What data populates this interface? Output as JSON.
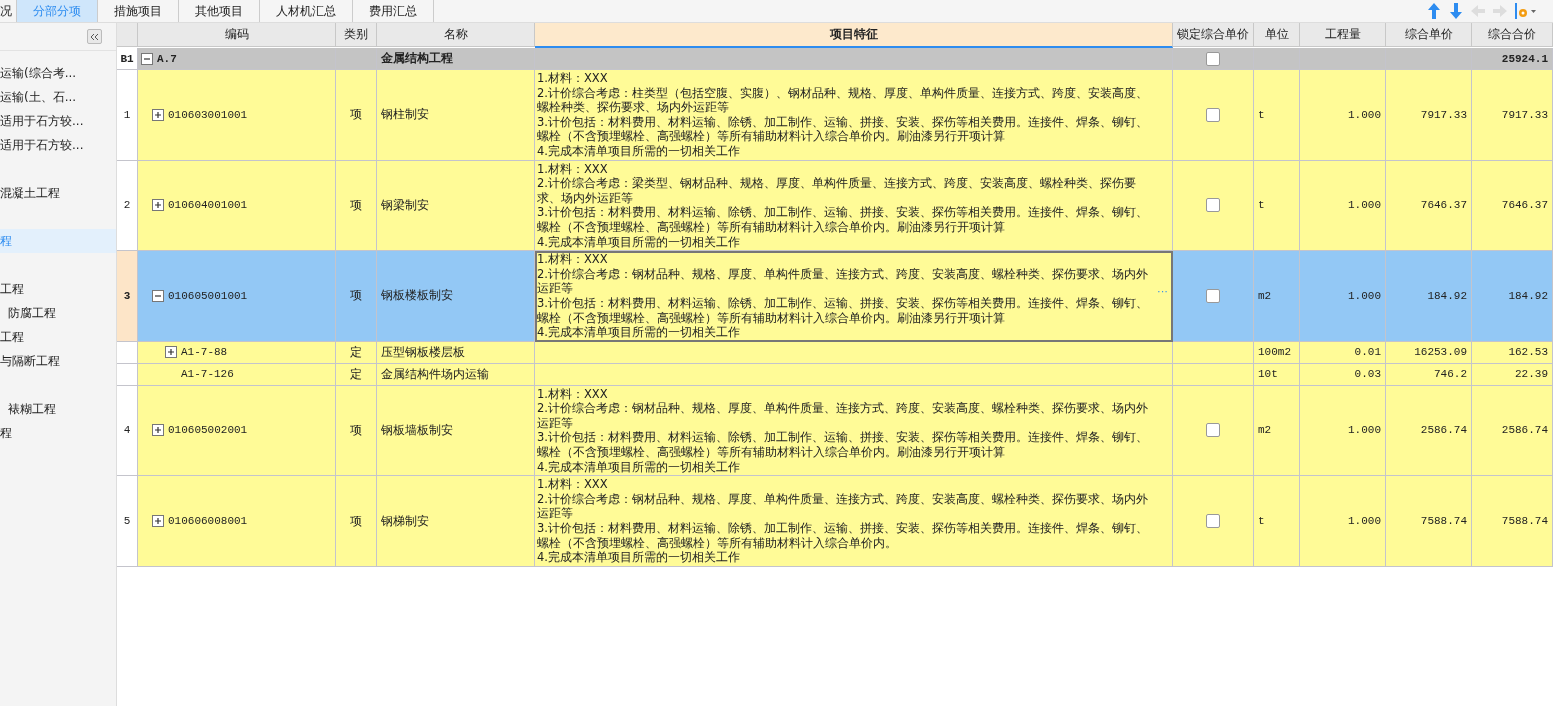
{
  "tabs": [
    {
      "label": "况",
      "selected": false
    },
    {
      "label": "分部分项",
      "selected": true
    },
    {
      "label": "措施项目",
      "selected": false
    },
    {
      "label": "其他项目",
      "selected": false
    },
    {
      "label": "人材机汇总",
      "selected": false
    },
    {
      "label": "费用汇总",
      "selected": false
    }
  ],
  "sidebar": {
    "items": [
      {
        "label": "运输(综合考...",
        "selected": false,
        "indented": false
      },
      {
        "label": "运输(土、石...",
        "selected": false,
        "indented": false
      },
      {
        "label": "适用于石方较...",
        "selected": false,
        "indented": false
      },
      {
        "label": "适用于石方较...",
        "selected": false,
        "indented": false
      },
      {
        "label": "混凝土工程",
        "selected": false,
        "indented": false
      },
      {
        "label": "程",
        "selected": true,
        "indented": false
      },
      {
        "label": "工程",
        "selected": false,
        "indented": false
      },
      {
        "label": "防腐工程",
        "selected": false,
        "indented": true
      },
      {
        "label": "工程",
        "selected": false,
        "indented": false
      },
      {
        "label": "与隔断工程",
        "selected": false,
        "indented": false
      },
      {
        "label": "裱糊工程",
        "selected": false,
        "indented": true
      },
      {
        "label": "程",
        "selected": false,
        "indented": false
      }
    ]
  },
  "table": {
    "columns": [
      "编码",
      "类别",
      "名称",
      "项目特征",
      "锁定综合单价",
      "单位",
      "工程量",
      "综合单价",
      "综合合价"
    ],
    "rows": [
      {
        "kind": "section",
        "number": "B1",
        "code": "A.7",
        "expanded": true,
        "name": "金属结构工程",
        "checked": false,
        "total": "25924.1",
        "selected": false
      },
      {
        "kind": "item",
        "number": "1",
        "code": "010603001001",
        "expanded": false,
        "type": "项",
        "name": "钢柱制安",
        "features": "1.材料：XXX\n2.计价综合考虑：柱类型（包括空腹、实腹）、钢材品种、规格、厚度、单构件质量、连接方式、跨度、安装高度、螺栓种类、探伤要求、场内外运距等\n3.计价包括：材料费用、材料运输、除锈、加工制作、运输、拼接、安装、探伤等相关费用。连接件、焊条、铆钉、螺栓（不含预埋螺栓、高强螺栓）等所有辅助材料计入综合单价内。刷油漆另行开项计算\n4.完成本清单项目所需的一切相关工作",
        "checked": false,
        "unit": "t",
        "quantity": "1.000",
        "price": "7917.33",
        "total": "7917.33",
        "selected": false
      },
      {
        "kind": "item",
        "number": "2",
        "code": "010604001001",
        "expanded": false,
        "type": "项",
        "name": "钢梁制安",
        "features": "1.材料：XXX\n2.计价综合考虑：梁类型、钢材品种、规格、厚度、单构件质量、连接方式、跨度、安装高度、螺栓种类、探伤要求、场内外运距等\n3.计价包括：材料费用、材料运输、除锈、加工制作、运输、拼接、安装、探伤等相关费用。连接件、焊条、铆钉、螺栓（不含预埋螺栓、高强螺栓）等所有辅助材料计入综合单价内。刷油漆另行开项计算\n4.完成本清单项目所需的一切相关工作",
        "checked": false,
        "unit": "t",
        "quantity": "1.000",
        "price": "7646.37",
        "total": "7646.37",
        "selected": false
      },
      {
        "kind": "item",
        "number": "3",
        "code": "010605001001",
        "expanded": true,
        "type": "项",
        "name": "钢板楼板制安",
        "features": "1.材料：XXX\n2.计价综合考虑：钢材品种、规格、厚度、单构件质量、连接方式、跨度、安装高度、螺栓种类、探伤要求、场内外运距等\n3.计价包括：材料费用、材料运输、除锈、加工制作、运输、拼接、安装、探伤等相关费用。连接件、焊条、铆钉、螺栓（不含预埋螺栓、高强螺栓）等所有辅助材料计入综合单价内。刷油漆另行开项计算\n4.完成本清单项目所需的一切相关工作",
        "more": "···",
        "checked": false,
        "unit": "m2",
        "quantity": "1.000",
        "price": "184.92",
        "total": "184.92",
        "selected": true
      },
      {
        "kind": "quota",
        "code": "A1-7-88",
        "expanded": false,
        "type": "定",
        "name": "压型钢板楼层板",
        "unit": "100m2",
        "quantity": "0.01",
        "price": "16253.09",
        "total": "162.53",
        "selected": false
      },
      {
        "kind": "quota",
        "code": "A1-7-126",
        "type": "定",
        "name": "金属结构件场内运输",
        "unit": "10t",
        "quantity": "0.03",
        "price": "746.2",
        "total": "22.39",
        "selected": false
      },
      {
        "kind": "item",
        "number": "4",
        "code": "010605002001",
        "expanded": false,
        "type": "项",
        "name": "钢板墙板制安",
        "features": "1.材料：XXX\n2.计价综合考虑：钢材品种、规格、厚度、单构件质量、连接方式、跨度、安装高度、螺栓种类、探伤要求、场内外运距等\n3.计价包括：材料费用、材料运输、除锈、加工制作、运输、拼接、安装、探伤等相关费用。连接件、焊条、铆钉、螺栓（不含预埋螺栓、高强螺栓）等所有辅助材料计入综合单价内。刷油漆另行开项计算\n4.完成本清单项目所需的一切相关工作",
        "checked": false,
        "unit": "m2",
        "quantity": "1.000",
        "price": "2586.74",
        "total": "2586.74",
        "selected": false
      },
      {
        "kind": "item",
        "number": "5",
        "code": "010606008001",
        "expanded": false,
        "type": "项",
        "name": "钢梯制安",
        "features": "1.材料：XXX\n2.计价综合考虑：钢材品种、规格、厚度、单构件质量、连接方式、跨度、安装高度、螺栓种类、探伤要求、场内外运距等\n3.计价包括：材料费用、材料运输、除锈、加工制作、运输、拼接、安装、探伤等相关费用。连接件、焊条、铆钉、螺栓（不含预埋螺栓、高强螺栓）等所有辅助材料计入综合单价内。\n4.完成本清单项目所需的一切相关工作",
        "checked": false,
        "unit": "t",
        "quantity": "1.000",
        "price": "7588.74",
        "total": "7588.74",
        "selected": false
      }
    ]
  }
}
